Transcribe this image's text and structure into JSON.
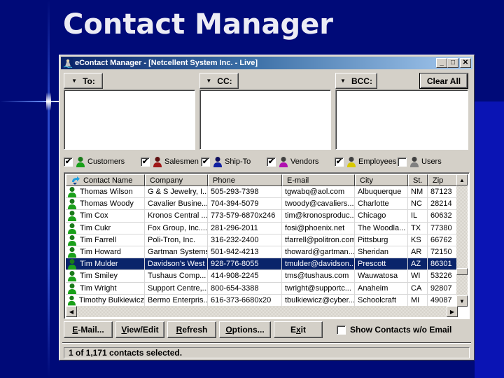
{
  "slide": {
    "title": "Contact Manager"
  },
  "window": {
    "title": "eContact Manager - [Netcellent System Inc. - Live]",
    "controls": {
      "minimize": "_",
      "maximize": "□",
      "close": "✕"
    }
  },
  "recipients": {
    "to_label": "To:",
    "cc_label": "CC:",
    "bcc_label": "BCC:",
    "clear_all_label": "Clear All"
  },
  "filters": [
    {
      "label": "Customers",
      "checked": true,
      "icon": "person-green-icon",
      "color": "#1a9a1a"
    },
    {
      "label": "Salesmen",
      "checked": true,
      "icon": "person-red-icon",
      "color": "#a01010"
    },
    {
      "label": "Ship-To",
      "checked": true,
      "icon": "person-blue-icon",
      "color": "#10208a"
    },
    {
      "label": "Vendors",
      "checked": true,
      "icon": "person-purple-icon",
      "color": "#a010a0"
    },
    {
      "label": "Employees",
      "checked": true,
      "icon": "person-yellow-icon",
      "color": "#c8b800"
    },
    {
      "label": "Users",
      "checked": false,
      "icon": "person-gray-icon",
      "color": "#808080"
    }
  ],
  "grid": {
    "columns": [
      "Contact Name",
      "Company",
      "Phone",
      "E-mail",
      "City",
      "St.",
      "Zip"
    ],
    "rows": [
      {
        "name": "Thomas Wilson",
        "company": "G & S Jewelry, I...",
        "phone": "505-293-7398",
        "email": "tgwabq@aol.com",
        "city": "Albuquerque",
        "st": "NM",
        "zip": "87123",
        "selected": false
      },
      {
        "name": "Thomas Woody",
        "company": "Cavalier Busine...",
        "phone": "704-394-5079",
        "email": "twoody@cavaliers...",
        "city": "Charlotte",
        "st": "NC",
        "zip": "28214",
        "selected": false
      },
      {
        "name": "Tim Cox",
        "company": "Kronos Central ...",
        "phone": "773-579-6870x246",
        "email": "tim@kronosproduc...",
        "city": "Chicago",
        "st": "IL",
        "zip": "60632",
        "selected": false
      },
      {
        "name": "Tim Cukr",
        "company": "Fox Group, Inc....",
        "phone": "281-296-2011",
        "email": "fosi@phoenix.net",
        "city": "The Woodla...",
        "st": "TX",
        "zip": "77380",
        "selected": false
      },
      {
        "name": "Tim Farrell",
        "company": "Poli-Tron, Inc.",
        "phone": "316-232-2400",
        "email": "tfarrell@politron.com",
        "city": "Pittsburg",
        "st": "KS",
        "zip": "66762",
        "selected": false
      },
      {
        "name": "Tim Howard",
        "company": "Gartman Systems",
        "phone": "501-942-4213",
        "email": "thoward@gartman...",
        "city": "Sheridan",
        "st": "AR",
        "zip": "72150",
        "selected": false
      },
      {
        "name": "Tim Mulder",
        "company": "Davidson's West",
        "phone": "928-776-8055",
        "email": "tmulder@davidson...",
        "city": "Prescott",
        "st": "AZ",
        "zip": "86301",
        "selected": true
      },
      {
        "name": "Tim Smiley",
        "company": "Tushaus Comp...",
        "phone": "414-908-2245",
        "email": "tms@tushaus.com",
        "city": "Wauwatosa",
        "st": "WI",
        "zip": "53226",
        "selected": false
      },
      {
        "name": "Tim Wright",
        "company": "Support Centre,...",
        "phone": "800-654-3388",
        "email": "twright@supportc...",
        "city": "Anaheim",
        "st": "CA",
        "zip": "92807",
        "selected": false
      },
      {
        "name": "Timothy Bulkiewicz",
        "company": "Bermo Enterpris...",
        "phone": "616-373-6680x20",
        "email": "tbulkiewicz@cyber...",
        "city": "Schoolcraft",
        "st": "MI",
        "zip": "49087",
        "selected": false
      }
    ]
  },
  "actions": {
    "email": {
      "pre": "",
      "ul": "E",
      "post": "-Mail..."
    },
    "view_edit": {
      "pre": "",
      "ul": "V",
      "post": "iew/Edit"
    },
    "refresh": {
      "pre": "",
      "ul": "R",
      "post": "efresh"
    },
    "options": {
      "pre": "",
      "ul": "O",
      "post": "ptions..."
    },
    "exit": {
      "pre": "E",
      "ul": "x",
      "post": "it"
    },
    "show_without_email": {
      "label": "Show Contacts w/o Email",
      "checked": false
    }
  },
  "status": {
    "text": "1 of 1,171 contacts selected."
  }
}
